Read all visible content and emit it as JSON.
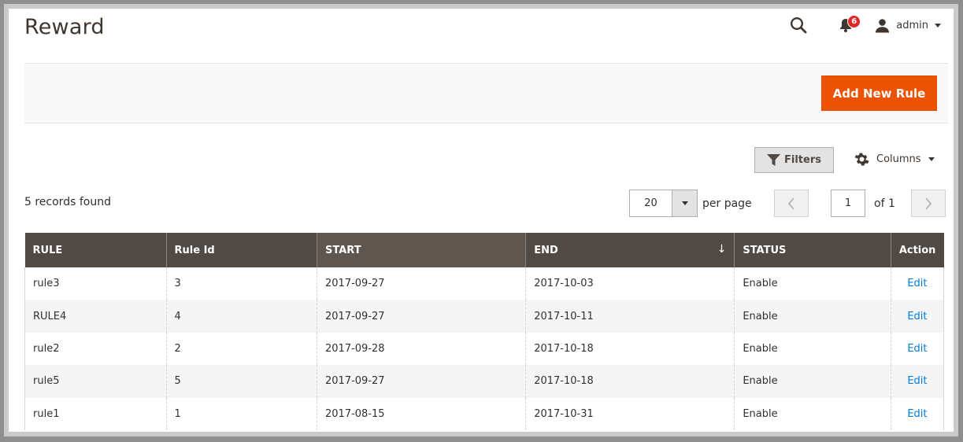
{
  "header": {
    "title": "Reward",
    "notifications_count": "6",
    "user": "admin"
  },
  "actions": {
    "add_new_rule": "Add New Rule"
  },
  "controls": {
    "filters": "Filters",
    "columns": "Columns",
    "records_found": "5 records found",
    "per_page_value": "20",
    "per_page_label": "per page",
    "page_value": "1",
    "page_of": "of 1"
  },
  "table": {
    "columns": [
      "RULE",
      "Rule Id",
      "START",
      "END",
      "STATUS",
      "Action"
    ],
    "rows": [
      {
        "rule": "rule3",
        "id": "3",
        "start": "2017-09-27",
        "end": "2017-10-03",
        "status": "Enable",
        "action": "Edit"
      },
      {
        "rule": "RULE4",
        "id": "4",
        "start": "2017-09-27",
        "end": "2017-10-11",
        "status": "Enable",
        "action": "Edit"
      },
      {
        "rule": "rule2",
        "id": "2",
        "start": "2017-09-28",
        "end": "2017-10-18",
        "status": "Enable",
        "action": "Edit"
      },
      {
        "rule": "rule5",
        "id": "5",
        "start": "2017-09-27",
        "end": "2017-10-18",
        "status": "Enable",
        "action": "Edit"
      },
      {
        "rule": "rule1",
        "id": "1",
        "start": "2017-08-15",
        "end": "2017-10-31",
        "status": "Enable",
        "action": "Edit"
      }
    ]
  },
  "icons": {
    "search": "search-icon",
    "notifications": "bell-icon",
    "user": "user-icon",
    "filter": "filter-icon",
    "columns": "gear-icon",
    "prev": "chevron-left-icon",
    "next": "chevron-right-icon"
  },
  "colors": {
    "accent": "#eb5202",
    "header_bg": "#514943",
    "link": "#007bdb",
    "badge": "#e22626"
  }
}
